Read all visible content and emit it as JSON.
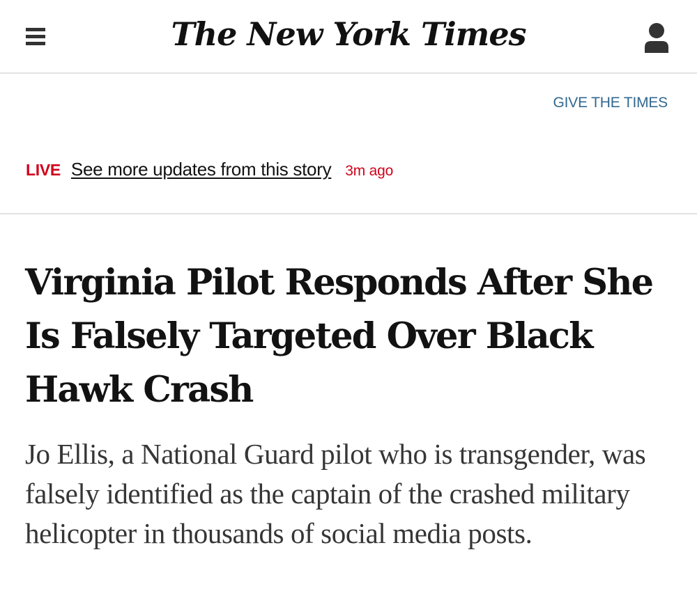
{
  "header": {
    "menu_icon": "hamburger-menu-icon",
    "logo_text": "The New York Times",
    "account_icon": "user-account-icon"
  },
  "promo": {
    "give_label": "GIVE THE TIMES"
  },
  "live": {
    "tag": "LIVE",
    "link_text": "See more updates from this story",
    "time": "3m ago"
  },
  "article": {
    "headline": "Virginia Pilot Responds After She Is Falsely Targeted Over Black Hawk Crash",
    "summary": "Jo Ellis, a National Guard pilot who is transgender, was falsely identified as the captain of the crashed military helicopter in thousands of social media posts."
  },
  "colors": {
    "live_red": "#d0021b",
    "link_blue": "#326891",
    "divider": "#e2e2e2"
  }
}
